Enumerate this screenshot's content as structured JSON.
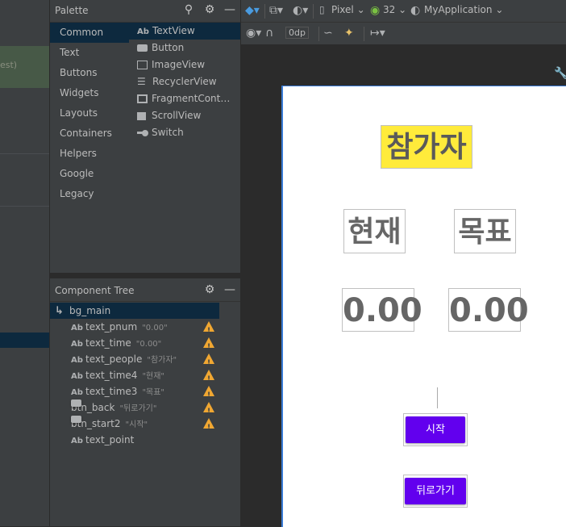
{
  "editor_fragment": "est)",
  "palette": {
    "title": "Palette",
    "categories": [
      "Common",
      "Text",
      "Buttons",
      "Widgets",
      "Layouts",
      "Containers",
      "Helpers",
      "Google",
      "Legacy"
    ],
    "widgets": [
      {
        "label": "TextView",
        "icon": "textview-icon"
      },
      {
        "label": "Button",
        "icon": "button-icon"
      },
      {
        "label": "ImageView",
        "icon": "imageview-icon"
      },
      {
        "label": "RecyclerView",
        "icon": "recyclerview-icon"
      },
      {
        "label": "FragmentCont…",
        "icon": "fragmentcontainer-icon"
      },
      {
        "label": "ScrollView",
        "icon": "scrollview-icon"
      },
      {
        "label": "Switch",
        "icon": "switch-icon"
      }
    ],
    "ab_glyph": "Ab"
  },
  "toolbar": {
    "device": "Pixel",
    "api": "32",
    "app": "MyApplication",
    "margin": "0dp"
  },
  "tree": {
    "title": "Component Tree",
    "root": "bg_main",
    "items": [
      {
        "name": "text_pnum",
        "value": "\"0.00\"",
        "kind": "text",
        "warning": true
      },
      {
        "name": "text_time",
        "value": "\"0.00\"",
        "kind": "text",
        "warning": true
      },
      {
        "name": "text_people",
        "value": "\"참가자\"",
        "kind": "text",
        "warning": true
      },
      {
        "name": "text_time4",
        "value": "\"현재\"",
        "kind": "text",
        "warning": true
      },
      {
        "name": "text_time3",
        "value": "\"목표\"",
        "kind": "text",
        "warning": true
      },
      {
        "name": "btn_back",
        "value": "\"뒤로가기\"",
        "kind": "button",
        "warning": true
      },
      {
        "name": "btn_start2",
        "value": "\"시작\"",
        "kind": "button",
        "warning": true
      },
      {
        "name": "text_point",
        "value": "",
        "kind": "text",
        "warning": false
      }
    ]
  },
  "preview": {
    "people": "참가자",
    "now_label": "현재",
    "target_label": "목표",
    "pnum": "0.00",
    "time": "0.00",
    "start_button": "시작",
    "back_button": "뒤로가기",
    "highlight_color": "#ffeb3b",
    "button_color": "#6200ee"
  }
}
